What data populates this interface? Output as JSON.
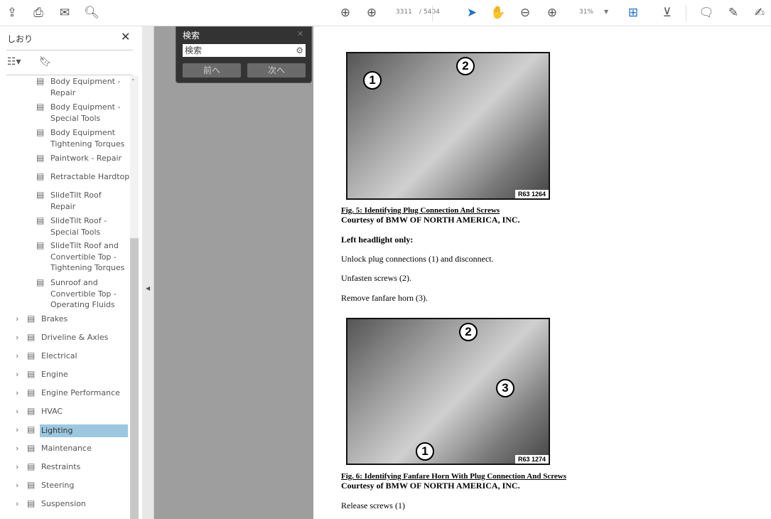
{
  "toolbar": {
    "icons": [
      "upload-icon",
      "print-icon",
      "email-icon",
      "search-zoom-icon"
    ],
    "current_page": "3311",
    "total_pages": "/ 5404",
    "zoom": "31%"
  },
  "sidebar": {
    "title": "しおり",
    "children": [
      {
        "label": "Body Equipment - Repair"
      },
      {
        "label": "Body Equipment - Special Tools"
      },
      {
        "label": "Body Equipment Tightening Torques"
      },
      {
        "label": "Paintwork - Repair"
      },
      {
        "label": "Retractable Hardtop"
      },
      {
        "label": "SlideTilt Roof Repair"
      },
      {
        "label": "SlideTilt Roof - Special Tools"
      },
      {
        "label": "SlideTilt Roof and Convertible Top - Tightening Torques"
      },
      {
        "label": "Sunroof and Convertible Top - Operating Fluids"
      }
    ],
    "sections": [
      {
        "label": "Brakes"
      },
      {
        "label": "Driveline & Axles"
      },
      {
        "label": "Electrical"
      },
      {
        "label": "Engine"
      },
      {
        "label": "Engine Performance"
      },
      {
        "label": "HVAC"
      },
      {
        "label": "Lighting",
        "selected": true
      },
      {
        "label": "Maintenance"
      },
      {
        "label": "Restraints"
      },
      {
        "label": "Steering"
      },
      {
        "label": "Suspension"
      }
    ]
  },
  "search": {
    "title": "検索",
    "placeholder": "検索",
    "prev": "前へ",
    "next": "次へ"
  },
  "document": {
    "fig5": {
      "label": "R63 1264",
      "callouts": [
        "1",
        "2"
      ],
      "caption": "Fig. 5: Identifying Plug Connection And Screws",
      "courtesy": "Courtesy of BMW OF NORTH AMERICA, INC."
    },
    "heading": "Left headlight only:",
    "steps": [
      "Unlock plug connections (1) and disconnect.",
      "Unfasten screws (2).",
      "Remove fanfare horn (3)."
    ],
    "fig6": {
      "label": "R63 1274",
      "callouts": [
        "2",
        "3",
        "1"
      ],
      "caption": "Fig. 6: Identifying Fanfare Horn With Plug Connection And Screws",
      "courtesy": "Courtesy of BMW OF NORTH AMERICA, INC."
    },
    "last": "Release screws (1)"
  }
}
